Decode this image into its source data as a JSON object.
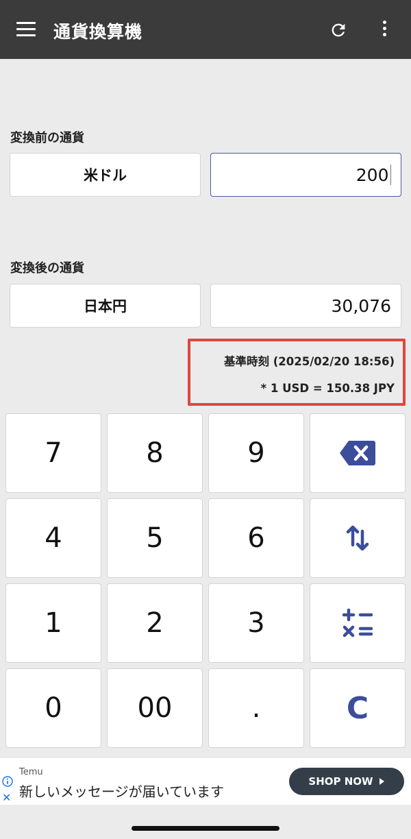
{
  "app": {
    "title": "通貨換算機"
  },
  "icons": {
    "menu": "menu-icon",
    "refresh": "refresh-icon",
    "more": "more-vert-icon"
  },
  "from": {
    "label": "変換前の通貨",
    "currency": "米ドル",
    "amount": "200"
  },
  "to": {
    "label": "変換後の通貨",
    "currency": "日本円",
    "amount": "30,076"
  },
  "rate": {
    "timestamp": "基準時刻 (2025/02/20 18:56)",
    "conversion": "* 1 USD = 150.38 JPY"
  },
  "keypad": {
    "k7": "7",
    "k8": "8",
    "k9": "9",
    "k4": "4",
    "k5": "5",
    "k6": "6",
    "k1": "1",
    "k2": "2",
    "k3": "3",
    "k0": "0",
    "k00": "00",
    "kdot": ".",
    "clear": "C"
  },
  "ad": {
    "brand": "Temu",
    "message": "新しいメッセージが届いています",
    "cta": "SHOP NOW"
  },
  "colors": {
    "accent": "#3b4d9b",
    "appbar": "#3b3b3b",
    "highlight": "#e0463e"
  }
}
